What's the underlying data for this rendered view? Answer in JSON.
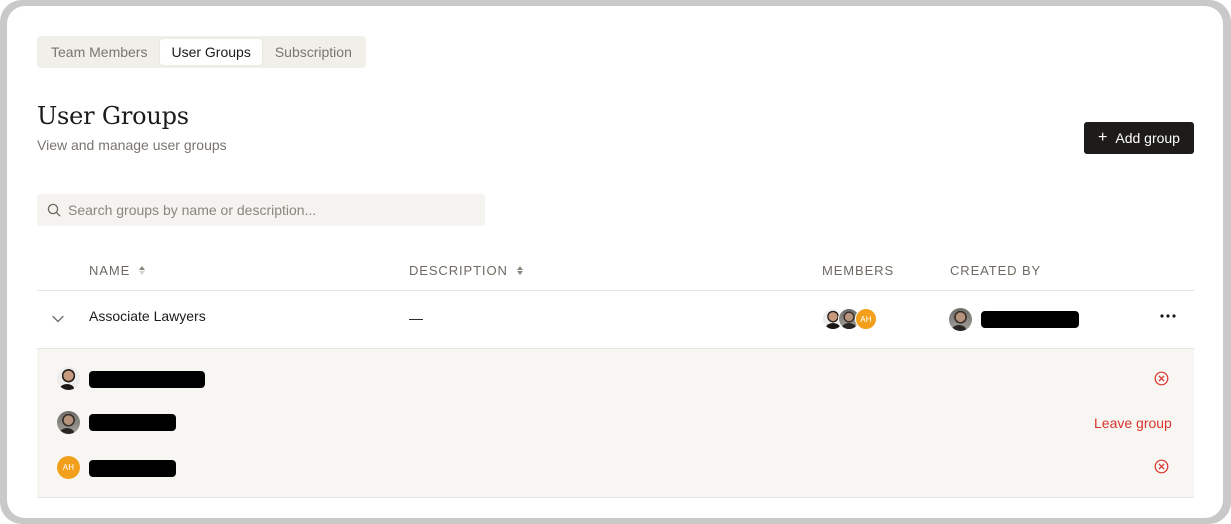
{
  "tabs": [
    {
      "label": "Team Members"
    },
    {
      "label": "User Groups"
    },
    {
      "label": "Subscription"
    }
  ],
  "header": {
    "title": "User Groups",
    "subtitle": "View and manage user groups",
    "add_button_label": "Add group",
    "add_button_icon": "+"
  },
  "search": {
    "placeholder": "Search groups by name or description..."
  },
  "table": {
    "columns": {
      "name": "NAME",
      "description": "DESCRIPTION",
      "members": "MEMBERS",
      "created_by": "CREATED BY"
    },
    "rows": [
      {
        "name": "Associate Lawyers",
        "description": "—",
        "member_avatars": [
          {
            "type": "photo"
          },
          {
            "type": "photo"
          },
          {
            "type": "initials",
            "initials": "AH"
          }
        ],
        "expanded": true,
        "members": [
          {
            "avatar": "photo",
            "action": "remove-icon"
          },
          {
            "avatar": "photo",
            "action_label": "Leave group"
          },
          {
            "avatar": "initials",
            "initials": "AH",
            "action": "remove-icon"
          }
        ]
      }
    ]
  },
  "colors": {
    "accent_dark": "#1e1c1a",
    "danger": "#d9352c",
    "avatar_orange": "#f2a01c",
    "expanded_bg": "#f7f6f3"
  }
}
